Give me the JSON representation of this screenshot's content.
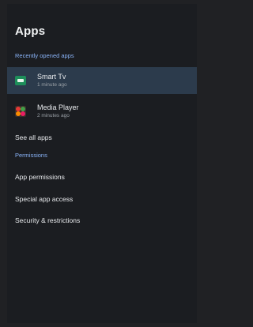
{
  "header": {
    "title": "Apps"
  },
  "recent": {
    "section_label": "Recently opened apps",
    "apps": [
      {
        "name": "Smart Tv",
        "subtitle": "1 minute ago",
        "icon": "tv-app-icon"
      },
      {
        "name": "Media Player",
        "subtitle": "2 minutes ago",
        "icon": "media-player-app-icon"
      }
    ],
    "see_all_label": "See all apps"
  },
  "permissions": {
    "section_label": "Permissions",
    "items": [
      {
        "label": "App permissions"
      },
      {
        "label": "Special app access"
      },
      {
        "label": "Security & restrictions"
      }
    ]
  },
  "colors": {
    "background": "#1b1d21",
    "accent": "#8ab4f8",
    "selected_row": "#2c3b4c"
  }
}
